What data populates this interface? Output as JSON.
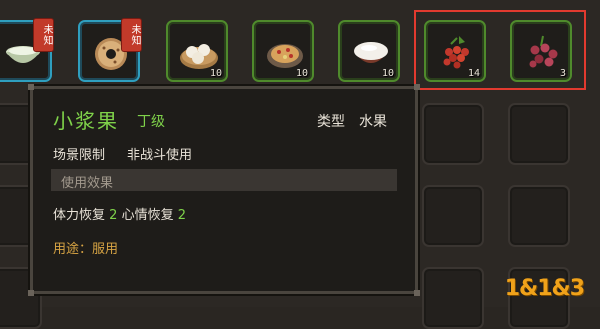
{
  "inventory": {
    "top_row": [
      {
        "icon": "rice-bowl-icon",
        "unknown": true,
        "badge": "未知",
        "count": ""
      },
      {
        "icon": "donut-icon",
        "unknown": true,
        "badge": "未知",
        "count": ""
      },
      {
        "icon": "steamed-buns-icon",
        "unknown": false,
        "badge": "",
        "count": "10"
      },
      {
        "icon": "food-plate-icon",
        "unknown": false,
        "badge": "",
        "count": "10"
      },
      {
        "icon": "rice-bowl-white-icon",
        "unknown": false,
        "badge": "",
        "count": "10"
      },
      {
        "icon": "red-berries-icon",
        "unknown": false,
        "badge": "",
        "count": "14"
      },
      {
        "icon": "purple-berries-icon",
        "unknown": false,
        "badge": "",
        "count": "3"
      }
    ]
  },
  "tooltip": {
    "name": "小浆果",
    "grade": "丁级",
    "type_label": "类型",
    "type_value": "水果",
    "scene_label": "场景限制",
    "scene_value": "非战斗使用",
    "effect_title": "使用效果",
    "effect_hp_label": "体力恢复",
    "effect_hp_value": "2",
    "effect_mood_label": "心情恢复",
    "effect_mood_value": "2",
    "usage": "用途：服用"
  },
  "watermark": "1&1&3",
  "colors": {
    "highlight": "#e23a2f",
    "grade_green": "#7fd24a",
    "unknown_blue": "#2f9fbf",
    "badge_red": "#c23a2a",
    "usage_gold": "#d9a544"
  }
}
